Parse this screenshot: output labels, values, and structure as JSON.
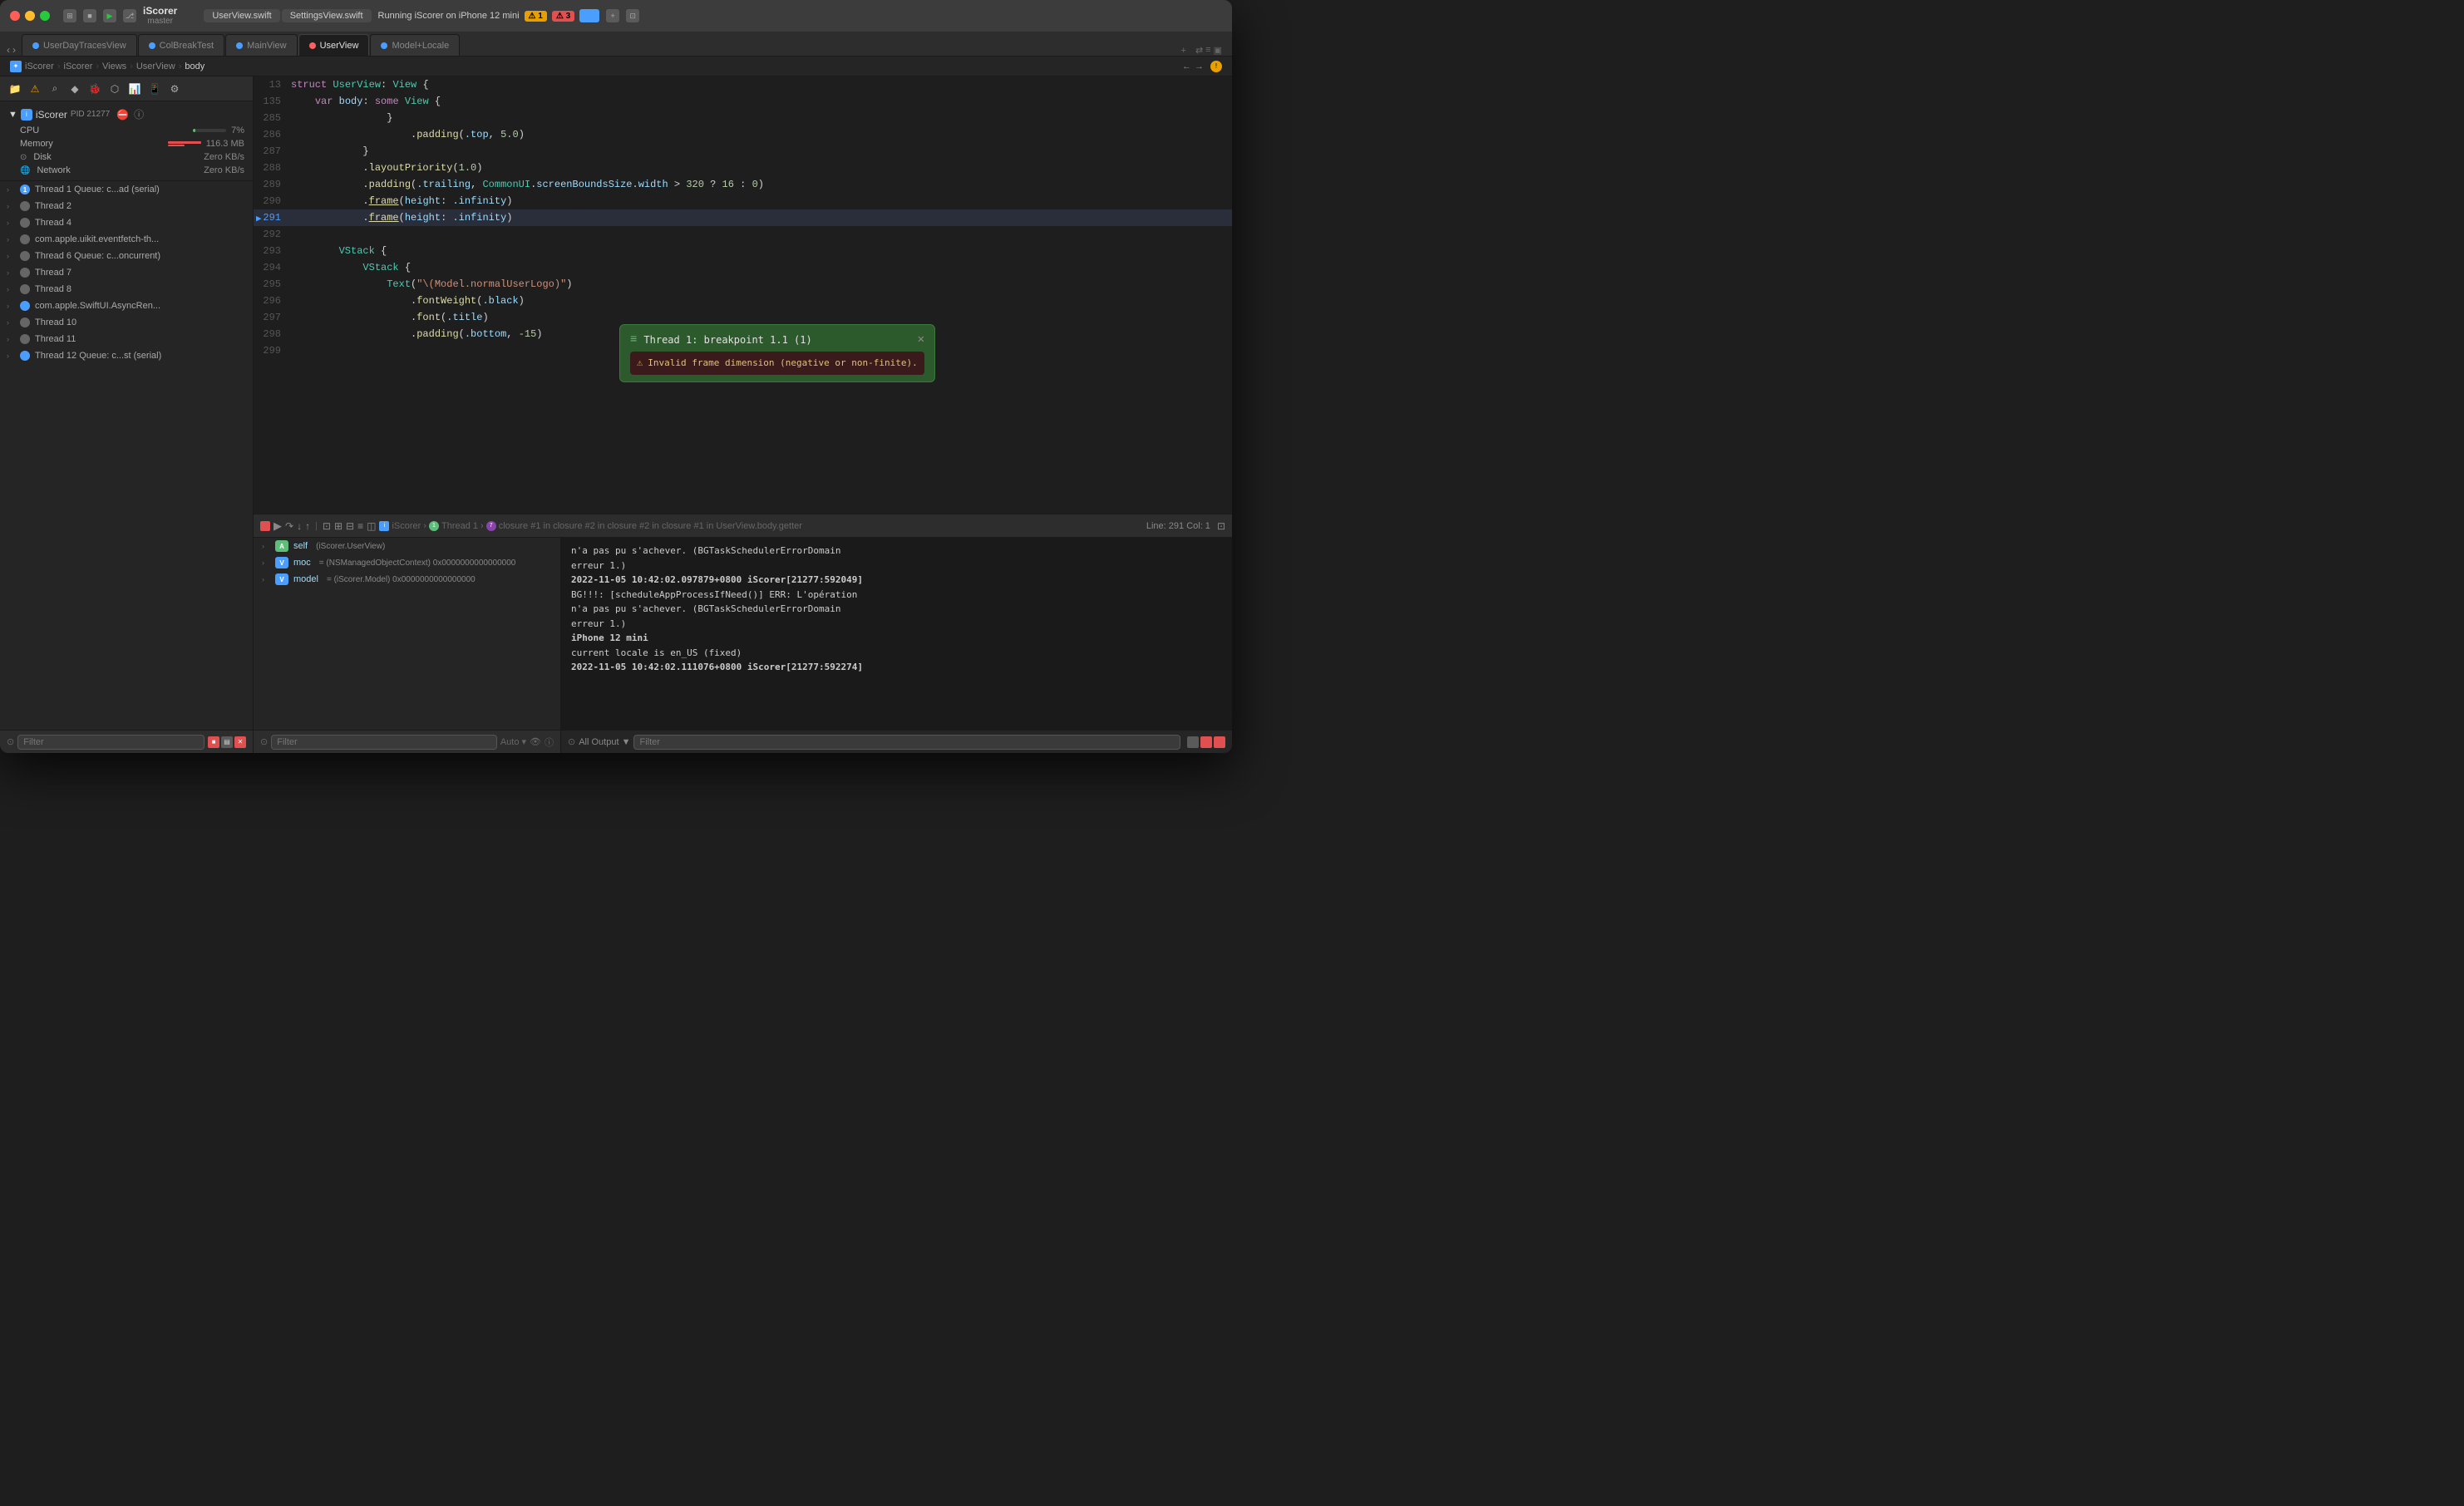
{
  "window": {
    "app_name": "iScorer",
    "branch": "master",
    "run_status": "Running iScorer on iPhone 12 mini",
    "warning_count": "1",
    "error_count": "3"
  },
  "titlebar": {
    "sidebar_toggle": "⊞",
    "stop_btn": "■",
    "run_btn": "▶",
    "branch_icon": "⎇"
  },
  "tabs_top": {
    "tab1": "UserView.swift",
    "tab2": "SettingsView.swift"
  },
  "file_tabs": [
    {
      "label": "UserDayTracesView",
      "dot": "blue"
    },
    {
      "label": "ColBreakTest",
      "dot": "blue"
    },
    {
      "label": "MainView",
      "dot": "blue"
    },
    {
      "label": "UserView",
      "dot": "red",
      "active": true
    },
    {
      "label": "Model+Locale",
      "dot": "blue"
    }
  ],
  "breadcrumb": {
    "items": [
      "iScorer",
      "iScorer",
      "Views",
      "UserView",
      "body"
    ]
  },
  "sidebar": {
    "process": {
      "name": "iScorer",
      "pid": "PID 21277"
    },
    "metrics": {
      "cpu": {
        "label": "CPU",
        "value": "7%",
        "bar_pct": 7
      },
      "memory": {
        "label": "Memory",
        "value": "116.3 MB",
        "bar_pct": 50
      },
      "disk": {
        "label": "Disk",
        "value": "Zero KB/s"
      },
      "network": {
        "label": "Network",
        "value": "Zero KB/s"
      }
    },
    "threads": [
      {
        "id": 1,
        "name": "Thread 1 Queue: c...ad (serial)",
        "has_indicator": true,
        "selected": false
      },
      {
        "id": 2,
        "name": "Thread 2",
        "has_indicator": false,
        "selected": false
      },
      {
        "id": 4,
        "name": "Thread 4",
        "has_indicator": false,
        "selected": false
      },
      {
        "id": 5,
        "name": "com.apple.uikit.eventfetch-th...",
        "has_indicator": false,
        "selected": false
      },
      {
        "id": 6,
        "name": "Thread 6 Queue: c...oncurrent)",
        "has_indicator": false,
        "selected": false
      },
      {
        "id": 7,
        "name": "Thread 7",
        "has_indicator": false,
        "selected": false
      },
      {
        "id": 8,
        "name": "Thread 8",
        "has_indicator": false,
        "selected": false
      },
      {
        "id": 9,
        "name": "com.apple.SwiftUI.AsyncRen...",
        "has_indicator": false,
        "selected": false
      },
      {
        "id": 10,
        "name": "Thread 10",
        "has_indicator": false,
        "selected": false
      },
      {
        "id": 11,
        "name": "Thread 11",
        "has_indicator": false,
        "selected": false
      },
      {
        "id": 12,
        "name": "Thread 12 Queue: c...st (serial)",
        "has_indicator": false,
        "selected": false
      }
    ],
    "filter_placeholder": "Filter"
  },
  "code_editor": {
    "file": "UserView.swift",
    "struct_line": "struct UserView: View {",
    "body_line": "    var body: some View {",
    "lines": [
      {
        "num": 13,
        "content": "struct UserView: View {"
      },
      {
        "num": 135,
        "content": "    var body: some View {"
      },
      {
        "num": 285,
        "content": "                }"
      },
      {
        "num": 286,
        "content": "                    .padding(.top, 5.0)"
      },
      {
        "num": 287,
        "content": "            }"
      },
      {
        "num": 288,
        "content": "            .layoutPriority(1.0)"
      },
      {
        "num": 289,
        "content": "            .padding(.trailing, CommonUI.screenBoundsSize.width > 320 ? 16 : 0)"
      },
      {
        "num": 290,
        "content": "            .frame(height: .infinity)"
      },
      {
        "num": 291,
        "content": "            .frame(height: .infinity)",
        "highlighted": true
      },
      {
        "num": 292,
        "content": ""
      },
      {
        "num": 293,
        "content": "        VStack {"
      },
      {
        "num": 294,
        "content": "            VStack {"
      },
      {
        "num": 295,
        "content": "                Text(\"\\(Model.normalUserLogo)\")"
      },
      {
        "num": 296,
        "content": "                    .fontWeight(.black)"
      },
      {
        "num": 297,
        "content": "                    .font(.title)"
      },
      {
        "num": 298,
        "content": "                    .padding(.bottom, -15)"
      },
      {
        "num": 299,
        "content": ""
      }
    ]
  },
  "breakpoint_popup": {
    "title": "Thread 1: breakpoint 1.1 (1)",
    "warning": "Invalid frame dimension (negative or non-finite)."
  },
  "debug_bar": {
    "breadcrumb": "iScorer › Thread 1 › 7 closure #1 in closure #2 in closure #2 in closure #1 in UserView.body.getter",
    "position": "Line: 291  Col: 1"
  },
  "variables": [
    {
      "type": "A",
      "name": "self",
      "value": "(iScorer.UserView)"
    },
    {
      "type": "V",
      "name": "moc",
      "value": "= (NSManagedObjectContext) 0x0000000000000000"
    },
    {
      "type": "V",
      "name": "model",
      "value": "= (iScorer.Model) 0x0000000000000000"
    }
  ],
  "console": {
    "output_label": "All Output ▼",
    "lines": [
      "n'a pas pu s'achever. (BGTaskSchedulerErrorDomain",
      "    erreur 1.)",
      "2022-11-05 10:42:02.097879+0800 iScorer[21277:592049]",
      "    BG!!!: [scheduleAppProcessIfNeed()] ERR: L'opération",
      "    n'a pas pu s'achever. (BGTaskSchedulerErrorDomain",
      "    erreur 1.)",
      "iPhone 12 mini",
      "current locale is en_US (fixed)",
      "2022-11-05 10:42:02.111076+0800 iScorer[21277:592274]"
    ]
  }
}
